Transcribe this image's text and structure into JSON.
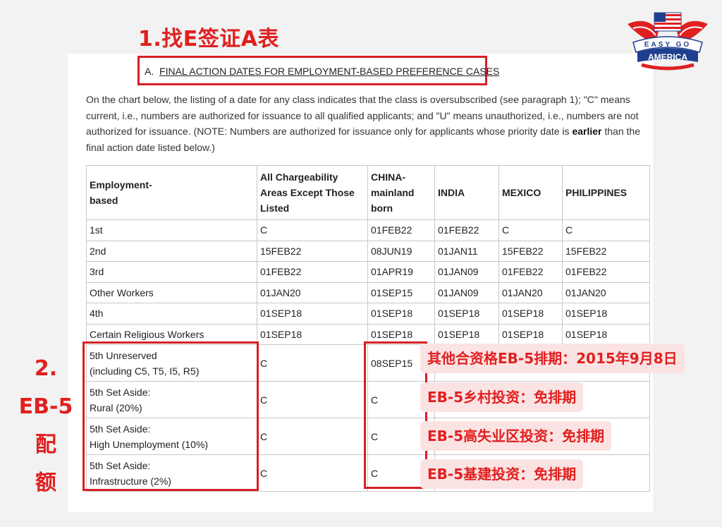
{
  "heading": "1.找E签证A表",
  "section": {
    "prefix": "A.",
    "title": "FINAL ACTION DATES FOR EMPLOYMENT-BASED PREFERENCE CASES"
  },
  "intro": {
    "part1": "On the chart below, the listing of a date for any class indicates that the class is oversubscribed (see paragraph 1); \"C\" means current, i.e., numbers are authorized for issuance to all qualified applicants; and \"U\" means unauthorized, i.e., numbers are not authorized for issuance. (NOTE: Numbers are authorized for issuance only for applicants whose priority date is ",
    "bold": "earlier",
    "part2": " than the final action date listed below.)"
  },
  "table": {
    "headers": [
      "Employment-\nbased",
      "All Chargeability Areas Except Those Listed",
      "CHINA-\nmainland born",
      "INDIA",
      "MEXICO",
      "PHILIPPINES"
    ],
    "rows": [
      [
        "1st",
        "C",
        "01FEB22",
        "01FEB22",
        "C",
        "C"
      ],
      [
        "2nd",
        "15FEB22",
        "08JUN19",
        "01JAN11",
        "15FEB22",
        "15FEB22"
      ],
      [
        "3rd",
        "01FEB22",
        "01APR19",
        "01JAN09",
        "01FEB22",
        "01FEB22"
      ],
      [
        "Other Workers",
        "01JAN20",
        "01SEP15",
        "01JAN09",
        "01JAN20",
        "01JAN20"
      ],
      [
        "4th",
        "01SEP18",
        "01SEP18",
        "01SEP18",
        "01SEP18",
        "01SEP18"
      ],
      [
        "Certain Religious Workers",
        "01SEP18",
        "01SEP18",
        "01SEP18",
        "01SEP18",
        "01SEP18"
      ]
    ],
    "eb5_rows": [
      [
        "5th Unreserved",
        "(including C5, T5, I5, R5)",
        "C",
        "08SEP15"
      ],
      [
        "5th Set Aside:",
        "Rural (20%)",
        "C",
        "C"
      ],
      [
        "5th Set Aside:",
        "High Unemployment (10%)",
        "C",
        "C"
      ],
      [
        "5th Set Aside:",
        "Infrastructure (2%)",
        "C",
        "C"
      ]
    ]
  },
  "side_label": [
    "2.",
    "EB-5",
    "配",
    "额"
  ],
  "annotations": [
    "其他合资格EB-5排期：2015年9月8日",
    "EB-5乡村投资：免排期",
    "EB-5高失业区投资：免排期",
    "EB-5基建投资：免排期"
  ],
  "logo": {
    "line1": "EASY GO",
    "line2": "AMERICA"
  },
  "colors": {
    "accent_red": "#e02020",
    "box_red": "#d71f26",
    "pill_bg": "#fbe3e3"
  }
}
